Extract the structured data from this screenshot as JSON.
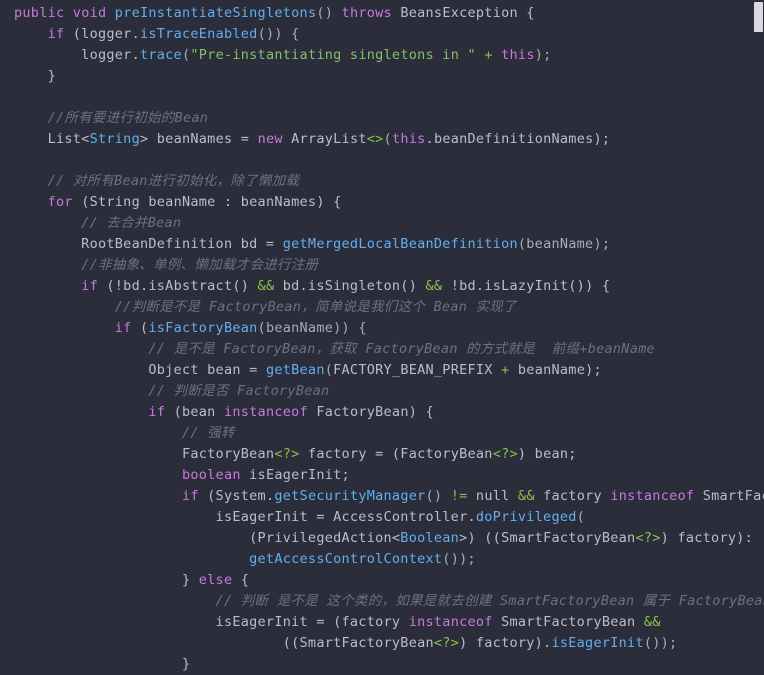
{
  "editor": {
    "language": "java",
    "background_color": "#2b2d3a",
    "theme": "dark",
    "colors": {
      "keyword": "#c778dd",
      "method": "#61afef",
      "string": "#84c06b",
      "comment": "#6b7185",
      "operator": "#8bc34a",
      "plain": "#b9bfca",
      "background": "#2b2d3a",
      "scrollbar_thumb": "#d8dae0"
    }
  },
  "scrollbar": {
    "name": "vertical-scrollbar",
    "thumb_position": "top"
  },
  "code_lines": [
    [
      {
        "t": "kw",
        "v": "public"
      },
      {
        "t": "plain",
        "v": " "
      },
      {
        "t": "kw",
        "v": "void"
      },
      {
        "t": "plain",
        "v": " "
      },
      {
        "t": "method",
        "v": "preInstantiateSingletons"
      },
      {
        "t": "punct",
        "v": "() "
      },
      {
        "t": "kw",
        "v": "throws"
      },
      {
        "t": "plain",
        "v": " BeansException {"
      }
    ],
    [
      {
        "t": "plain",
        "v": "    "
      },
      {
        "t": "kw",
        "v": "if"
      },
      {
        "t": "plain",
        "v": " (logger."
      },
      {
        "t": "method",
        "v": "isTraceEnabled"
      },
      {
        "t": "punct",
        "v": "()) {"
      }
    ],
    [
      {
        "t": "plain",
        "v": "        logger."
      },
      {
        "t": "method",
        "v": "trace"
      },
      {
        "t": "punct",
        "v": "("
      },
      {
        "t": "str",
        "v": "\"Pre-instantiating singletons in \""
      },
      {
        "t": "plain",
        "v": " "
      },
      {
        "t": "op",
        "v": "+"
      },
      {
        "t": "plain",
        "v": " "
      },
      {
        "t": "kw",
        "v": "this"
      },
      {
        "t": "punct",
        "v": ");"
      }
    ],
    [
      {
        "t": "plain",
        "v": "    }"
      }
    ],
    [],
    [
      {
        "t": "plain",
        "v": "    "
      },
      {
        "t": "comment",
        "v": "//所有要进行初始的Bean"
      }
    ],
    [
      {
        "t": "plain",
        "v": "    List<"
      },
      {
        "t": "gtype",
        "v": "String"
      },
      {
        "t": "plain",
        "v": "> beanNames = "
      },
      {
        "t": "kw",
        "v": "new"
      },
      {
        "t": "plain",
        "v": " ArrayList"
      },
      {
        "t": "op",
        "v": "<>"
      },
      {
        "t": "punct",
        "v": "("
      },
      {
        "t": "kw",
        "v": "this"
      },
      {
        "t": "plain",
        "v": ".beanDefinitionNames);"
      }
    ],
    [],
    [
      {
        "t": "plain",
        "v": "    "
      },
      {
        "t": "comment",
        "v": "// 对所有Bean进行初始化，除了懒加载"
      }
    ],
    [
      {
        "t": "plain",
        "v": "    "
      },
      {
        "t": "kw",
        "v": "for"
      },
      {
        "t": "plain",
        "v": " (String beanName : beanNames) {"
      }
    ],
    [
      {
        "t": "plain",
        "v": "        "
      },
      {
        "t": "comment",
        "v": "// 去合并Bean"
      }
    ],
    [
      {
        "t": "plain",
        "v": "        RootBeanDefinition bd = "
      },
      {
        "t": "method",
        "v": "getMergedLocalBeanDefinition"
      },
      {
        "t": "punct",
        "v": "(beanName);"
      }
    ],
    [
      {
        "t": "plain",
        "v": "        "
      },
      {
        "t": "comment",
        "v": "//非抽象、单例、懒加载才会进行注册"
      }
    ],
    [
      {
        "t": "plain",
        "v": "        "
      },
      {
        "t": "kw",
        "v": "if"
      },
      {
        "t": "plain",
        "v": " (!bd.isAbstract() "
      },
      {
        "t": "op",
        "v": "&&"
      },
      {
        "t": "plain",
        "v": " bd.isSingleton() "
      },
      {
        "t": "op",
        "v": "&&"
      },
      {
        "t": "plain",
        "v": " !bd.isLazyInit()) {"
      }
    ],
    [
      {
        "t": "plain",
        "v": "            "
      },
      {
        "t": "comment",
        "v": "//判断是不是 FactoryBean，简单说是我们这个 Bean 实现了"
      }
    ],
    [
      {
        "t": "plain",
        "v": "            "
      },
      {
        "t": "kw",
        "v": "if"
      },
      {
        "t": "plain",
        "v": " ("
      },
      {
        "t": "method",
        "v": "isFactoryBean"
      },
      {
        "t": "punct",
        "v": "(beanName)) {"
      }
    ],
    [
      {
        "t": "plain",
        "v": "                "
      },
      {
        "t": "comment",
        "v": "// 是不是 FactoryBean，获取 FactoryBean 的方式就是  前缀+beanName"
      }
    ],
    [
      {
        "t": "plain",
        "v": "                Object bean = "
      },
      {
        "t": "method",
        "v": "getBean"
      },
      {
        "t": "punct",
        "v": "("
      },
      {
        "t": "plain",
        "v": "FACTORY_BEAN_PREFIX "
      },
      {
        "t": "op",
        "v": "+"
      },
      {
        "t": "plain",
        "v": " beanName);"
      }
    ],
    [
      {
        "t": "plain",
        "v": "                "
      },
      {
        "t": "comment",
        "v": "// 判断是否 FactoryBean"
      }
    ],
    [
      {
        "t": "plain",
        "v": "                "
      },
      {
        "t": "kw",
        "v": "if"
      },
      {
        "t": "plain",
        "v": " (bean "
      },
      {
        "t": "kw",
        "v": "instanceof"
      },
      {
        "t": "plain",
        "v": " FactoryBean) {"
      }
    ],
    [
      {
        "t": "plain",
        "v": "                    "
      },
      {
        "t": "comment",
        "v": "// 强转"
      }
    ],
    [
      {
        "t": "plain",
        "v": "                    FactoryBean"
      },
      {
        "t": "op",
        "v": "<?>"
      },
      {
        "t": "plain",
        "v": " factory = (FactoryBean"
      },
      {
        "t": "op",
        "v": "<?>"
      },
      {
        "t": "plain",
        "v": ") bean;"
      }
    ],
    [
      {
        "t": "plain",
        "v": "                    "
      },
      {
        "t": "kw",
        "v": "boolean"
      },
      {
        "t": "plain",
        "v": " isEagerInit;"
      }
    ],
    [
      {
        "t": "plain",
        "v": "                    "
      },
      {
        "t": "kw",
        "v": "if"
      },
      {
        "t": "plain",
        "v": " (System."
      },
      {
        "t": "method",
        "v": "getSecurityManager"
      },
      {
        "t": "punct",
        "v": "() "
      },
      {
        "t": "op",
        "v": "!="
      },
      {
        "t": "plain",
        "v": " null "
      },
      {
        "t": "op",
        "v": "&&"
      },
      {
        "t": "plain",
        "v": " factory "
      },
      {
        "t": "kw",
        "v": "instanceof"
      },
      {
        "t": "plain",
        "v": " SmartFacto"
      }
    ],
    [
      {
        "t": "plain",
        "v": "                        isEagerInit = AccessController."
      },
      {
        "t": "method",
        "v": "doPrivileged"
      },
      {
        "t": "punct",
        "v": "("
      }
    ],
    [
      {
        "t": "plain",
        "v": "                            (PrivilegedAction<"
      },
      {
        "t": "gtype",
        "v": "Boolean"
      },
      {
        "t": "plain",
        "v": ">) ((SmartFactoryBean"
      },
      {
        "t": "op",
        "v": "<?>"
      },
      {
        "t": "plain",
        "v": ") factory):"
      }
    ],
    [
      {
        "t": "plain",
        "v": "                            "
      },
      {
        "t": "method",
        "v": "getAccessControlContext"
      },
      {
        "t": "punct",
        "v": "());"
      }
    ],
    [
      {
        "t": "plain",
        "v": "                    } "
      },
      {
        "t": "kw",
        "v": "else"
      },
      {
        "t": "plain",
        "v": " {"
      }
    ],
    [
      {
        "t": "plain",
        "v": "                        "
      },
      {
        "t": "comment",
        "v": "// 判断 是不是 这个类的，如果是就去创建 SmartFactoryBean 属于 FactoryBean"
      }
    ],
    [
      {
        "t": "plain",
        "v": "                        isEagerInit = (factory "
      },
      {
        "t": "kw",
        "v": "instanceof"
      },
      {
        "t": "plain",
        "v": " SmartFactoryBean "
      },
      {
        "t": "op",
        "v": "&&"
      }
    ],
    [
      {
        "t": "plain",
        "v": "                                ((SmartFactoryBean"
      },
      {
        "t": "op",
        "v": "<?>"
      },
      {
        "t": "plain",
        "v": ") factory)."
      },
      {
        "t": "method",
        "v": "isEagerInit"
      },
      {
        "t": "punct",
        "v": "());"
      }
    ],
    [
      {
        "t": "plain",
        "v": "                    }"
      }
    ]
  ]
}
